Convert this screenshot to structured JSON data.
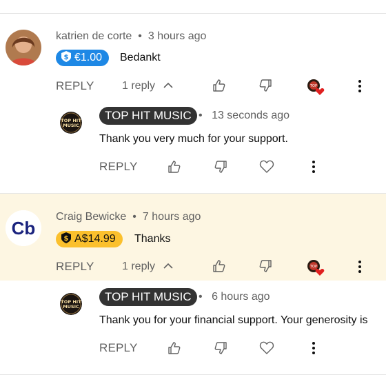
{
  "comments": [
    {
      "author": "katrien de corte",
      "time": "3 hours ago",
      "donation": "€1.00",
      "text": "Bedankt",
      "reply_label": "REPLY",
      "replies_count": "1 reply",
      "reply": {
        "author": "TOP HIT MUSIC",
        "time": "13 seconds ago",
        "text": "Thank you very much for your support.",
        "reply_label": "REPLY"
      }
    },
    {
      "author": "Craig Bewicke",
      "avatar_text": "Cb",
      "time": "7 hours ago",
      "donation": "A$14.99",
      "text": "Thanks",
      "reply_label": "REPLY",
      "replies_count": "1 reply",
      "reply": {
        "author": "TOP HIT MUSIC",
        "time": "6 hours ago",
        "text": "Thank you for your financial support. Your generosity is",
        "reply_label": "REPLY"
      }
    }
  ],
  "channel_logo_text": [
    "TOP HIT",
    "MUSIC"
  ],
  "separator": "•",
  "icons": [
    "like-icon",
    "dislike-icon",
    "heart-icon",
    "more-vert-icon",
    "chevron-up-icon",
    "coin-icon"
  ],
  "colors": {
    "donation_blue": "#1e88e5",
    "donation_yellow": "#fbc02d",
    "highlight_bg": "#fdf6e2",
    "heart_red": "#e02020",
    "owner_chip": "#333333"
  }
}
